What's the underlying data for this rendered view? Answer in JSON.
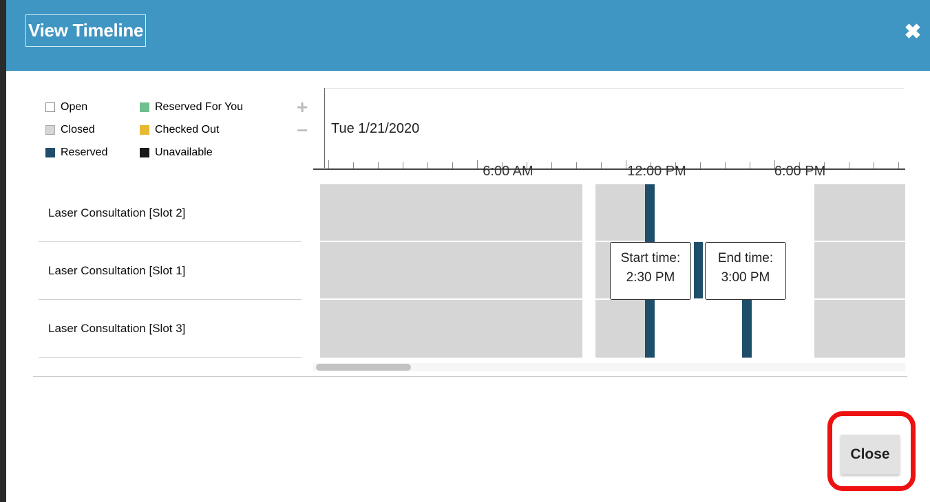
{
  "dialog": {
    "title": "View Timeline",
    "close_icon": "close-x-icon",
    "close_button_label": "Close"
  },
  "legend": {
    "items": [
      {
        "label": "Open",
        "color": "#ffffff"
      },
      {
        "label": "Closed",
        "color": "#d6d6d6"
      },
      {
        "label": "Reserved",
        "color": "#1f4e6b"
      },
      {
        "label": "Reserved For You",
        "color": "#6fbf8f"
      },
      {
        "label": "Checked Out",
        "color": "#e8b830"
      },
      {
        "label": "Unavailable",
        "color": "#1a1a1a"
      }
    ],
    "zoom_in_icon": "plus-icon",
    "zoom_out_icon": "minus-icon"
  },
  "timeline": {
    "date": "Tue 1/21/2020",
    "axis_labels": [
      "6:00 AM",
      "12:00 PM",
      "6:00 PM"
    ],
    "rows": [
      {
        "label": "Laser Consultation [Slot 2]"
      },
      {
        "label": "Laser Consultation [Slot 1]"
      },
      {
        "label": "Laser Consultation [Slot 3]"
      }
    ],
    "tooltip_start": {
      "label": "Start time:",
      "value": "2:30 PM"
    },
    "tooltip_end": {
      "label": "End time:",
      "value": "3:00 PM"
    }
  },
  "colors": {
    "header": "#3f96c3",
    "closed": "#d6d6d6",
    "reserved": "#1f4e6b",
    "highlight": "#ee1111"
  }
}
